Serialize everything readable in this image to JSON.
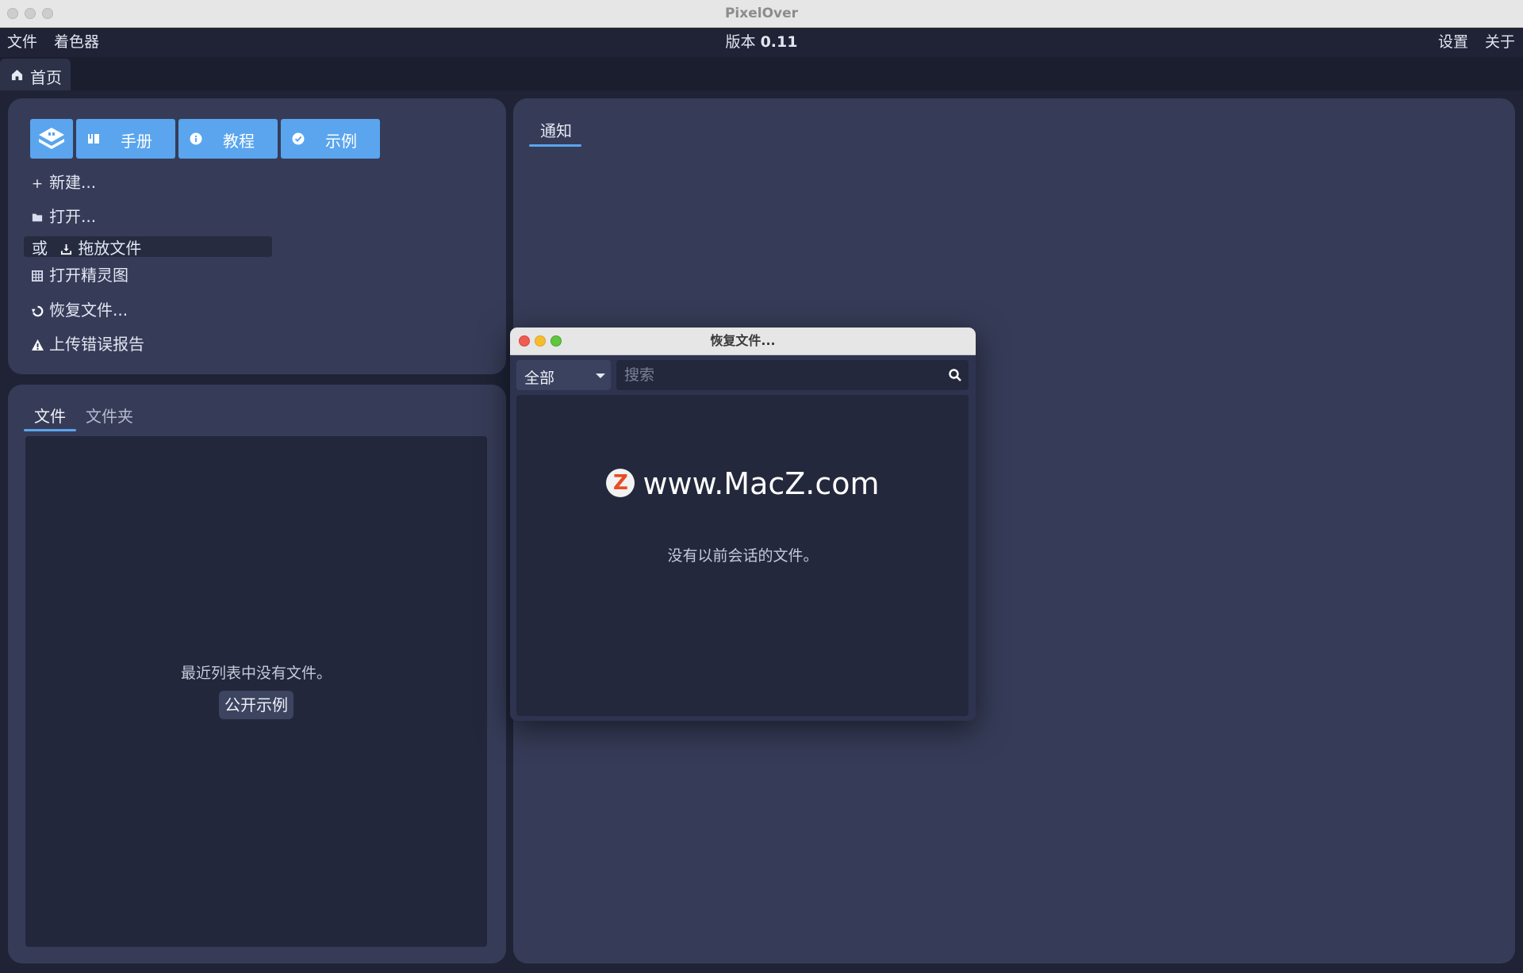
{
  "window": {
    "title": "PixelOver"
  },
  "menubar": {
    "file": "文件",
    "shader": "着色器",
    "version_label": "版本",
    "version_number": "0.11",
    "settings": "设置",
    "about": "关于"
  },
  "tabs": {
    "home": "首页"
  },
  "start_panel": {
    "buttons": {
      "manual": "手册",
      "tutorial": "教程",
      "examples": "示例"
    },
    "new": "新建...",
    "open": "打开...",
    "or": "或",
    "drop_files": "拖放文件",
    "open_spritesheet": "打开精灵图",
    "recover_files": "恢复文件...",
    "upload_error_report": "上传错误报告"
  },
  "files_panel": {
    "tabs": {
      "files": "文件",
      "folders": "文件夹"
    },
    "empty_message": "最近列表中没有文件。",
    "open_examples_button": "公开示例"
  },
  "notifications_panel": {
    "tab": "通知"
  },
  "recover_dialog": {
    "title": "恢复文件...",
    "filter_selected": "全部",
    "search_placeholder": "搜索",
    "watermark": "www.MacZ.com",
    "empty_message": "没有以前会话的文件。"
  },
  "colors": {
    "accent": "#5aa5ee",
    "panel": "#363c58",
    "background": "#1f2335"
  }
}
